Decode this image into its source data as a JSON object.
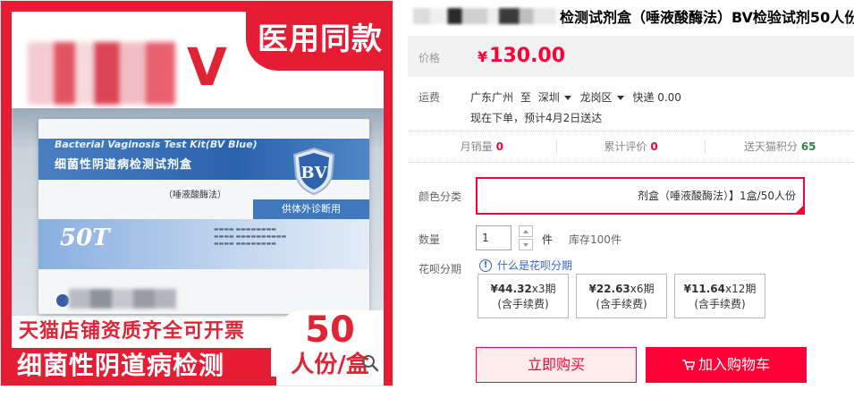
{
  "gallery": {
    "tag": "医用同款",
    "brand_letter": "V",
    "box": {
      "en_title": "Bacterial Vaginosis Test Kit(BV Blue)",
      "cn_title": "细菌性阴道病检测试剂盒",
      "method": "（唾液酸酶法）",
      "ivd": "供体外诊断用",
      "shield": "BV",
      "count": "50T"
    },
    "promo_line1": "天猫店铺资质齐全可开票",
    "promo_line2": "细菌性阴道病检测",
    "badge_num": "50",
    "badge_unit": "人份/盒"
  },
  "product": {
    "title": "检测试剂盒（唾液酸酶法）BV检验试剂50人份"
  },
  "price": {
    "label": "价格",
    "symbol": "¥",
    "value": "130.00"
  },
  "shipping": {
    "label": "运费",
    "from": "广东广州",
    "to_word": "至",
    "city": "深圳",
    "district": "龙岗区",
    "method": "快递 0.00",
    "eta": "现在下单，预计4月2日送达"
  },
  "stats": [
    {
      "label": "月销量",
      "value": "0"
    },
    {
      "label": "累计评价",
      "value": "0"
    },
    {
      "label": "送天猫积分",
      "value": "65"
    }
  ],
  "sku": {
    "label": "颜色分类",
    "selected": "剂盒（唾液酸酶法）】1盒/50人份"
  },
  "quantity": {
    "label": "数量",
    "value": "1",
    "unit": "件",
    "stock": "库存100件"
  },
  "huabei": {
    "label": "花呗分期",
    "link": "什么是花呗分期",
    "plans": [
      {
        "amount": "¥44.32",
        "periods": "x3期",
        "fee": "(含手续费)"
      },
      {
        "amount": "¥22.63",
        "periods": "x6期",
        "fee": "(含手续费)"
      },
      {
        "amount": "¥11.64",
        "periods": "x12期",
        "fee": "(含手续费)"
      }
    ]
  },
  "actions": {
    "buy": "立即购买",
    "cart": "加入购物车"
  },
  "colors": {
    "accent": "#ff0036",
    "promo_red": "#e61c35",
    "link_blue": "#3366cc"
  }
}
